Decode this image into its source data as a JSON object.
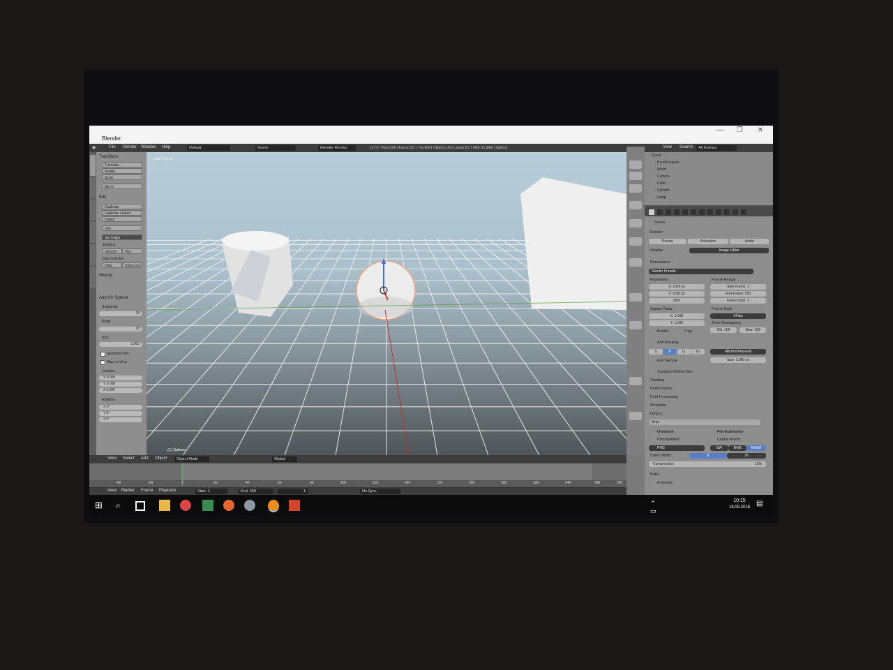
{
  "titlebar": {
    "title": "Blender"
  },
  "menu": {
    "items": [
      "File",
      "Render",
      "Window",
      "Help"
    ],
    "layout": "Default",
    "scene": "Scene",
    "engine": "Blender Render",
    "info": "v2.79 | Verts:290 | Faces:231 | Tris:568 | Objects:1/5 | Lamps:0/1 | Mem:11.86M | Sphere"
  },
  "toolshelf": {
    "transform_header": "Transform",
    "transform_buttons": [
      "Translate",
      "Rotate",
      "Scale",
      "Mirror"
    ],
    "edit_header": "Edit",
    "edit_buttons": [
      "Duplicate",
      "Duplicate Linked",
      "Delete",
      "Join"
    ],
    "set_origin": "Set Origin",
    "shading": "Shading:",
    "smooth": "Smooth",
    "flat": "Flat",
    "data_transfer": "Data Transfer:",
    "data": "Data",
    "data_layout": "Data Layo",
    "history": "History",
    "op_header": "Add UV Sphere",
    "segments": "Segments",
    "segments_val": "24",
    "rings": "Rings",
    "rings_val": "18",
    "size": "Size",
    "size_val": "1.000",
    "gen_uvs": "Generate UVs",
    "align_view": "Align to View",
    "location": "Location",
    "loc": [
      "X  0.000",
      "Y  0.000",
      "Z  0.000"
    ],
    "rotation": "Rotation",
    "rot": [
      "X  0°",
      "Y  0°",
      "Z  0°"
    ]
  },
  "viewport": {
    "label": "User Persp",
    "selected": "(1) Sphere"
  },
  "outliner": {
    "view": "View",
    "search": "Search",
    "filter": "All Scenes",
    "rows": [
      "Scene",
      "RenderLayers",
      "World",
      "Camera",
      "Cube",
      "Cylinder",
      "Lamp"
    ]
  },
  "props": {
    "scene": "Scene",
    "render_header": "Render",
    "render_btns": [
      "Render",
      "Animation",
      "Audio"
    ],
    "display": "Display",
    "display_val": "Image Editor",
    "dimensions": "Dimensions",
    "presets": "Render Presets",
    "resolution": "Resolution:",
    "res": [
      "X:  1920 px",
      "Y:  1080 px",
      "50%"
    ],
    "frame_range": "Frame Range:",
    "frames": [
      "Start Frame:  1",
      "End Frame:  250",
      "Frame Step:  1"
    ],
    "aspect": "Aspect Ratio:",
    "asp": [
      "X:  1.000",
      "Y:  1.000"
    ],
    "frame_rate": "Frame Rate:",
    "fps": "24 fps",
    "time_remap": "Time Remapping:",
    "old": "Old: 100",
    "new": "New: 100",
    "border": "Border",
    "crop": "Crop",
    "aa": "Anti-Aliasing",
    "aa_samples": [
      "5",
      "8",
      "11",
      "16"
    ],
    "filter": "Mitchell-Netravali",
    "full_sample": "Full Sample",
    "aa_size": "Size:  1.000 px",
    "collapsed": [
      "Sampled Motion Blur",
      "Shading",
      "Performance",
      "Post Processing",
      "Metadata"
    ],
    "output": "Output",
    "path": "/tmp\\",
    "overwrite": "Overwrite",
    "file_ext": "File Extensions",
    "placeholders": "Placeholders",
    "cache": "Cache Result",
    "format": "PNG",
    "color_modes": [
      "BW",
      "RGB",
      "RGBA"
    ],
    "color_depth": "Color Depth:",
    "depth": [
      "8",
      "16"
    ],
    "compression": "Compression:",
    "compression_val": "15%",
    "bake": "Bake",
    "freestyle": "Freestyle"
  },
  "viewport_header": {
    "items": [
      "View",
      "Select",
      "Add",
      "Object"
    ],
    "mode": "Object Mode",
    "orientation": "Global"
  },
  "timeline": {
    "ticks": [
      "-40",
      "-20",
      "0",
      "20",
      "40",
      "60",
      "80",
      "100",
      "120",
      "140",
      "160",
      "180",
      "200",
      "220",
      "240",
      "260",
      "280"
    ],
    "menu": [
      "View",
      "Marker",
      "Frame",
      "Playback"
    ],
    "start": "Start:",
    "start_val": "1",
    "end": "End:",
    "end_val": "250",
    "current": "1",
    "sync": "No Sync"
  },
  "taskbar": {
    "time": "10:15",
    "date": "18.09.2018"
  }
}
